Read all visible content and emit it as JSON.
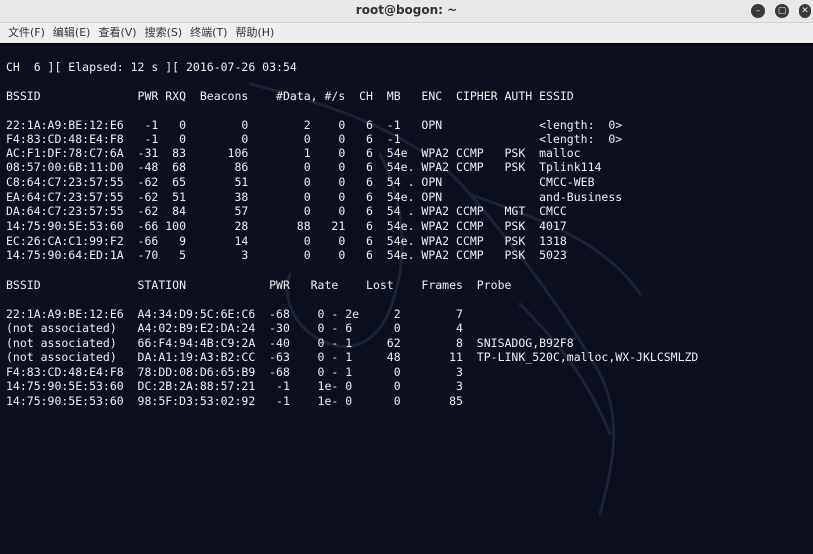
{
  "window": {
    "title": "root@bogon: ~",
    "min_icon": "minimize-icon",
    "max_icon": "maximize-icon",
    "close_icon": "close-icon"
  },
  "menu": [
    "文件(F)",
    "编辑(E)",
    "查看(V)",
    "搜索(S)",
    "终端(T)",
    "帮助(H)"
  ],
  "terminal": {
    "status": "CH  6 ][ Elapsed: 12 s ][ 2016-07-26 03:54",
    "ap_header": "BSSID              PWR RXQ  Beacons    #Data, #/s  CH  MB   ENC  CIPHER AUTH ESSID",
    "ap_rows": [
      "22:1A:A9:BE:12:E6   -1   0        0        2    0   6  -1   OPN              <length:  0>",
      "F4:83:CD:48:E4:F8   -1   0        0        0    0   6  -1                    <length:  0>",
      "AC:F1:DF:78:C7:6A  -31  83      106        1    0   6  54e  WPA2 CCMP   PSK  malloc",
      "08:57:00:6B:11:D0  -48  68       86        0    0   6  54e. WPA2 CCMP   PSK  Tplink114",
      "C8:64:C7:23:57:55  -62  65       51        0    0   6  54 . OPN              CMCC-WEB",
      "EA:64:C7:23:57:55  -62  51       38        0    0   6  54e. OPN              and-Business",
      "DA:64:C7:23:57:55  -62  84       57        0    0   6  54 . WPA2 CCMP   MGT  CMCC",
      "14:75:90:5E:53:60  -66 100       28       88   21   6  54e. WPA2 CCMP   PSK  4017",
      "EC:26:CA:C1:99:F2  -66   9       14        0    0   6  54e. WPA2 CCMP   PSK  1318",
      "14:75:90:64:ED:1A  -70   5        3        0    0   6  54e. WPA2 CCMP   PSK  5023"
    ],
    "sta_header": "BSSID              STATION            PWR   Rate    Lost    Frames  Probe",
    "sta_rows": [
      "22:1A:A9:BE:12:E6  A4:34:D9:5C:6E:C6  -68    0 - 2e     2        7",
      "(not associated)   A4:02:B9:E2:DA:24  -30    0 - 6      0        4",
      "(not associated)   66:F4:94:4B:C9:2A  -40    0 - 1     62        8  SNISADOG,B92F8",
      "(not associated)   DA:A1:19:A3:B2:CC  -63    0 - 1     48       11  TP-LINK_520C,malloc,WX-JKLCSMLZD",
      "F4:83:CD:48:E4:F8  78:DD:08:D6:65:B9  -68    0 - 1      0        3",
      "14:75:90:5E:53:60  DC:2B:2A:88:57:21   -1    1e- 0      0        3",
      "14:75:90:5E:53:60  98:5F:D3:53:02:92   -1    1e- 0      0       85"
    ]
  }
}
